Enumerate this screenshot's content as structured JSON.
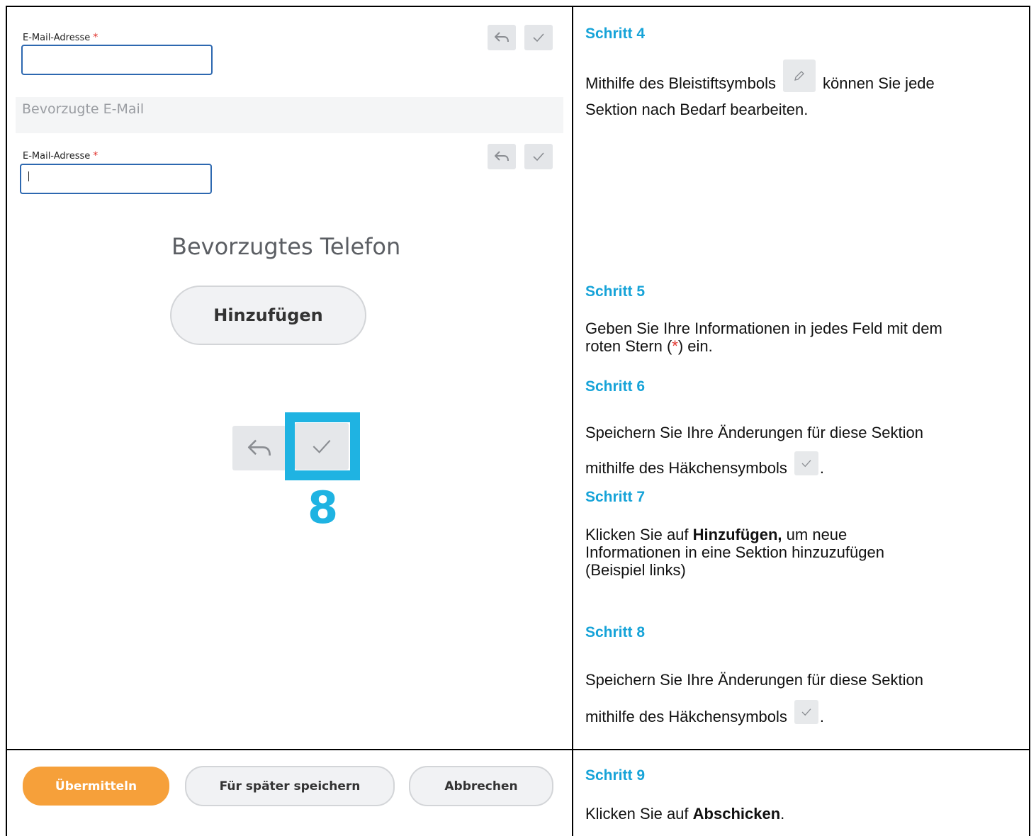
{
  "left": {
    "email_label": "E-Mail-Adresse",
    "required_mark": "*",
    "section_title": "Bevorzugte E-Mail",
    "email_label_2": "E-Mail-Adresse",
    "phone_heading": "Bevorzugtes Telefon",
    "add_button": "Hinzufügen",
    "callout_number": "8"
  },
  "buttons": {
    "submit": "Übermitteln",
    "save_later": "Für später speichern",
    "cancel": "Abbrechen"
  },
  "steps": {
    "s4_title": "Schritt 4",
    "s4_text_a": "Mithilfe des Bleistiftsymbols",
    "s4_text_b": "können Sie jede",
    "s4_text_c": "Sektion nach Bedarf bearbeiten.",
    "s5_title": "Schritt 5",
    "s5_text_a": "Geben Sie Ihre Informationen in jedes Feld mit dem",
    "s5_text_b": "roten Stern (",
    "s5_star": "*",
    "s5_text_c": ") ein.",
    "s6_title": "Schritt 6",
    "s6_text_a": "Speichern Sie Ihre Änderungen für diese Sektion",
    "s6_text_b": "mithilfe des Häkchensymbols",
    "s6_text_c": ".",
    "s7_title": "Schritt 7",
    "s7_text_a": "Klicken Sie auf",
    "s7_bold": "Hinzufügen,",
    "s7_text_b": "um neue",
    "s7_text_c": "Informationen in eine Sektion hinzuzufügen",
    "s7_text_d": "(Beispiel links)",
    "s8_title": "Schritt 8",
    "s8_text_a": "Speichern Sie Ihre Änderungen für diese Sektion",
    "s8_text_b": "mithilfe des Häkchensymbols",
    "s8_text_c": ".",
    "s9_title": "Schritt 9",
    "s9_text_a": "Klicken Sie auf",
    "s9_bold": "Abschicken",
    "s9_text_b": "."
  },
  "colors": {
    "accent": "#16a3d8",
    "highlight": "#1fb3e2",
    "submit": "#f6a03a",
    "required": "#e0312b"
  },
  "icons": [
    "undo-icon",
    "checkmark-icon",
    "pencil-icon"
  ]
}
